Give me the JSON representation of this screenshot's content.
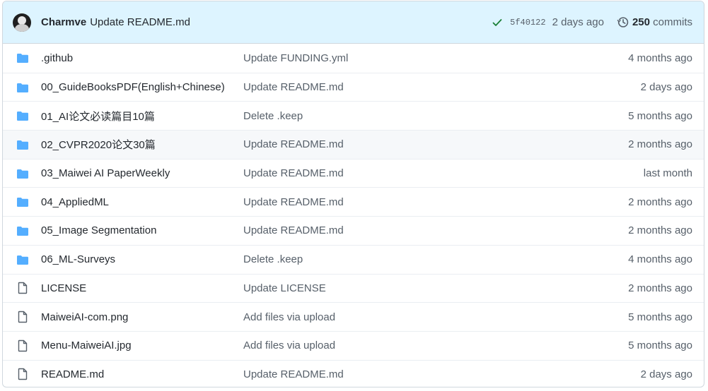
{
  "header": {
    "author": "Charmve",
    "commit_message": "Update README.md",
    "sha": "5f40122",
    "age": "2 days ago",
    "commits_count": "250",
    "commits_label": "commits"
  },
  "colors": {
    "header_bg": "#ddf4ff",
    "folder": "#54aeff",
    "check": "#1a7f37",
    "border": "#d0d7de"
  },
  "rows": [
    {
      "type": "folder",
      "name": ".github",
      "message": "Update FUNDING.yml",
      "time": "4 months ago"
    },
    {
      "type": "folder",
      "name": "00_GuideBooksPDF(English+Chinese)",
      "message": "Update README.md",
      "time": "2 days ago"
    },
    {
      "type": "folder",
      "name": "01_AI论文必读篇目10篇",
      "message": "Delete .keep",
      "time": "5 months ago"
    },
    {
      "type": "folder",
      "name": "02_CVPR2020论文30篇",
      "message": "Update README.md",
      "time": "2 months ago"
    },
    {
      "type": "folder",
      "name": "03_Maiwei AI PaperWeekly",
      "message": "Update README.md",
      "time": "last month"
    },
    {
      "type": "folder",
      "name": "04_AppliedML",
      "message": "Update README.md",
      "time": "2 months ago"
    },
    {
      "type": "folder",
      "name": "05_Image Segmentation",
      "message": "Update README.md",
      "time": "2 months ago"
    },
    {
      "type": "folder",
      "name": "06_ML-Surveys",
      "message": "Delete .keep",
      "time": "4 months ago"
    },
    {
      "type": "file",
      "name": "LICENSE",
      "message": "Update LICENSE",
      "time": "2 months ago"
    },
    {
      "type": "file",
      "name": "MaiweiAI-com.png",
      "message": "Add files via upload",
      "time": "5 months ago"
    },
    {
      "type": "file",
      "name": "Menu-MaiweiAI.jpg",
      "message": "Add files via upload",
      "time": "5 months ago"
    },
    {
      "type": "file",
      "name": "README.md",
      "message": "Update README.md",
      "time": "2 days ago"
    }
  ]
}
